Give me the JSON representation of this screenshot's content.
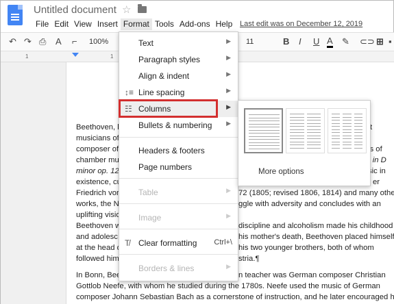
{
  "header": {
    "title": "Untitled document",
    "last_edit": "Last edit was on December 12, 2019"
  },
  "menubar": [
    "File",
    "Edit",
    "View",
    "Insert",
    "Format",
    "Tools",
    "Add-ons",
    "Help"
  ],
  "toolbar": {
    "zoom": "100%",
    "font_size": "11"
  },
  "ruler": {
    "ticks": [
      "1",
      "1",
      "2",
      "3",
      "4",
      "5",
      "6",
      "7"
    ]
  },
  "format_menu": {
    "items": [
      {
        "label": "Text",
        "arrow": "▶",
        "disabled": false
      },
      {
        "label": "Paragraph styles",
        "arrow": "▶",
        "disabled": false
      },
      {
        "label": "Align & indent",
        "arrow": "▶",
        "disabled": false
      },
      {
        "label": "Line spacing",
        "arrow": "▶",
        "disabled": false
      },
      {
        "label": "Columns",
        "arrow": "▶",
        "disabled": false,
        "highlighted": true
      },
      {
        "label": "Bullets & numbering",
        "arrow": "▶",
        "disabled": false
      },
      {
        "label": "Headers & footers",
        "disabled": false
      },
      {
        "label": "Page numbers",
        "disabled": false
      },
      {
        "label": "Table",
        "arrow": "▶",
        "disabled": true
      },
      {
        "label": "Image",
        "arrow": "▶",
        "disabled": true
      },
      {
        "label": "Clear formatting",
        "shortcut": "Ctrl+\\",
        "disabled": false
      },
      {
        "label": "Borders & lines",
        "arrow": "▶",
        "disabled": true
      }
    ]
  },
  "columns_submenu": {
    "more_options": "More options"
  },
  "document": {
    "lines": [
      "Beethoven, l",
      "musicians of",
      "composer of",
      "chamber mu",
      "minor op. 12",
      "existence, cu",
      "Friedrich vor",
      "works, the N",
      "uplifting visio",
      "Beethoven w",
      "and adolesc",
      "at the head o",
      "followed him",
      "In Bonn, Bee",
      "Gottlob Neefe, with whom he studied during the 1780s. Neefe used the music of German",
      "composer Johann Sebastian Bach as a cornerstone of instruction, and he later encouraged his"
    ],
    "right_fragments": [
      "t",
      "ls of",
      ". 9 in D",
      "sic in",
      "er",
      "72 (1805; revised 1806, 1814) and many other",
      "ggle with adversity and concludes with an",
      "discipline and alcoholism made his childhood",
      "his mother's death, Beethoven placed himself",
      "his two younger brothers, both of whom",
      "stria.¶",
      "n teacher was German composer Christian"
    ]
  },
  "colors": {
    "accent": "#4285f4",
    "highlight_box": "#d32f2f"
  }
}
